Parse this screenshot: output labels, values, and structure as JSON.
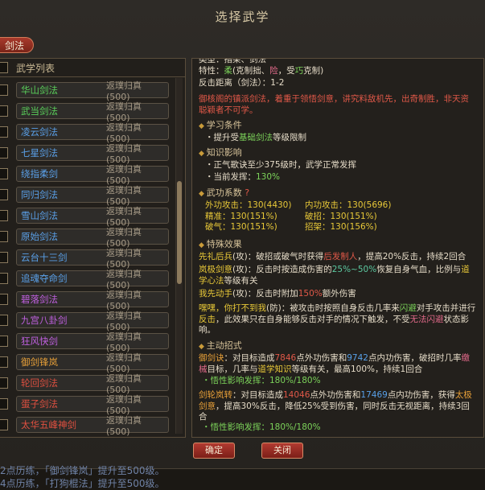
{
  "window": {
    "title": "选择武学"
  },
  "tab": {
    "label": "剑法"
  },
  "list": {
    "header": "武学列表",
    "items": [
      {
        "name": "华山剑法",
        "rank": "返璞归真 (500)",
        "color": "#5ad05a"
      },
      {
        "name": "武当剑法",
        "rank": "返璞归真 (500)",
        "color": "#5ad05a"
      },
      {
        "name": "凌云剑法",
        "rank": "返璞归真 (500)",
        "color": "#5aa0e8"
      },
      {
        "name": "七星剑法",
        "rank": "返璞归真 (500)",
        "color": "#5aa0e8"
      },
      {
        "name": "绕指柔剑",
        "rank": "返璞归真 (500)",
        "color": "#5aa0e8"
      },
      {
        "name": "同归剑法",
        "rank": "返璞归真 (500)",
        "color": "#5aa0e8"
      },
      {
        "name": "雪山剑法",
        "rank": "返璞归真 (500)",
        "color": "#5aa0e8"
      },
      {
        "name": "原始剑法",
        "rank": "返璞归真 (500)",
        "color": "#5aa0e8"
      },
      {
        "name": "云台十三剑",
        "rank": "返璞归真 (500)",
        "color": "#5aa0e8"
      },
      {
        "name": "追魂夺命剑",
        "rank": "返璞归真 (500)",
        "color": "#5aa0e8"
      },
      {
        "name": "碧落剑法",
        "rank": "返璞归真 (500)",
        "color": "#c060e0"
      },
      {
        "name": "九宫八卦剑",
        "rank": "返璞归真 (500)",
        "color": "#c060e0"
      },
      {
        "name": "狂风快剑",
        "rank": "返璞归真 (500)",
        "color": "#c060e0"
      },
      {
        "name": "御剑锋岚",
        "rank": "返璞归真 (500)",
        "color": "#e8a038"
      },
      {
        "name": "轮回剑法",
        "rank": "返璞归真 (500)",
        "color": "#e05040"
      },
      {
        "name": "蛋子剑法",
        "rank": "返璞归真 (500)",
        "color": "#e05040"
      },
      {
        "name": "太华五峰神剑",
        "rank": "返璞归真 (500)",
        "color": "#e05040"
      }
    ]
  },
  "detail": {
    "type_line": "类型：指架、剑法",
    "trait_prefix": "特性：",
    "trait_rou": "柔",
    "trait_mid": "(克制拙、",
    "trait_xian": "险",
    "trait_mid2": "，受",
    "trait_qiao": "巧",
    "trait_end": "克制)",
    "range": "反击距离（剑法）：1-2",
    "desc": "御核阁的镇派剑法，着重于领悟剑意，讲究料敌机先，出奇制胜，非天资聪颖者不可学。",
    "learn_title": "学习条件",
    "learn_a": "・提升受",
    "learn_b": "基础剑法",
    "learn_c": "等级限制",
    "know_title": "知识影响",
    "know_1": "・正气歌诀至少375级时，武学正常发挥",
    "know_2a": "・当前发挥：",
    "know_2b": "130%",
    "coef_title": "武功系数",
    "coef_q": "?",
    "coef": [
      "外功攻击：130(4430)",
      "内功攻击：130(5696)",
      "精准：130(151%)",
      "破招：130(151%)",
      "破气：130(151%)",
      "招架：130(156%)"
    ],
    "spec_title": "特殊效果",
    "spec1a": "先礼后兵",
    "spec1b": "(攻)：破招或破气时获得",
    "spec1c": "后发制人",
    "spec1d": "，提高20%反击，持续2回合",
    "spec2a": "岚极剑意",
    "spec2b": "(攻)：反击时按造成伤害的",
    "spec2c": "25%~50%",
    "spec2d": "恢复自身气血，比例与",
    "spec2e": "道学心法",
    "spec2f": "等级有关",
    "spec3a": "我先动手",
    "spec3b": "(攻)：反击时附加",
    "spec3c": "150%",
    "spec3d": "额外伤害",
    "spec4a": "嘿嘿，你打不到我",
    "spec4b": "(防)：被攻击时按照自身反击几率来",
    "spec4c": "闪避",
    "spec4d": "对手攻击并进行",
    "spec4e": "反击",
    "spec4f": "，此效果只在自身能够反击对手的情况下触发，不受",
    "spec4g": "无法闪避",
    "spec4h": "状态影响。",
    "act_title": "主动招式",
    "act1a": "御剑诀",
    "act1b": "：对目标造成",
    "act1c": "7846",
    "act1d": "点外功伤害和",
    "act1e": "9742",
    "act1f": "点内功伤害，破招时几率",
    "act1g": "缴械",
    "act1h": "目标，几率与",
    "act1i": "道学知识",
    "act1j": "等级有关，最高100%，持续1回合",
    "act1k": "・悟性影响发挥：180%/180%",
    "act2a": "剑轮岚转",
    "act2b": "：对目标造成",
    "act2c": "14046",
    "act2d": "点外功伤害和",
    "act2e": "17469",
    "act2f": "点内功伤害，获得",
    "act2g": "太极剑意",
    "act2h": "，提高30%反击，降低25%受到伤害，同时反击无视距离，持续3回合",
    "act2k": "・悟性影响发挥：180%/180%"
  },
  "buttons": {
    "confirm": "确定",
    "close": "关闭"
  },
  "log": {
    "line1": "2点历练，「御剑锋岚」提升至500级。",
    "line2": "4点历练，「打狗棍法」提升至500级。"
  },
  "colors": {
    "accent": "#a83a2c",
    "panel": "#23201c",
    "border": "#5a4d3b"
  }
}
